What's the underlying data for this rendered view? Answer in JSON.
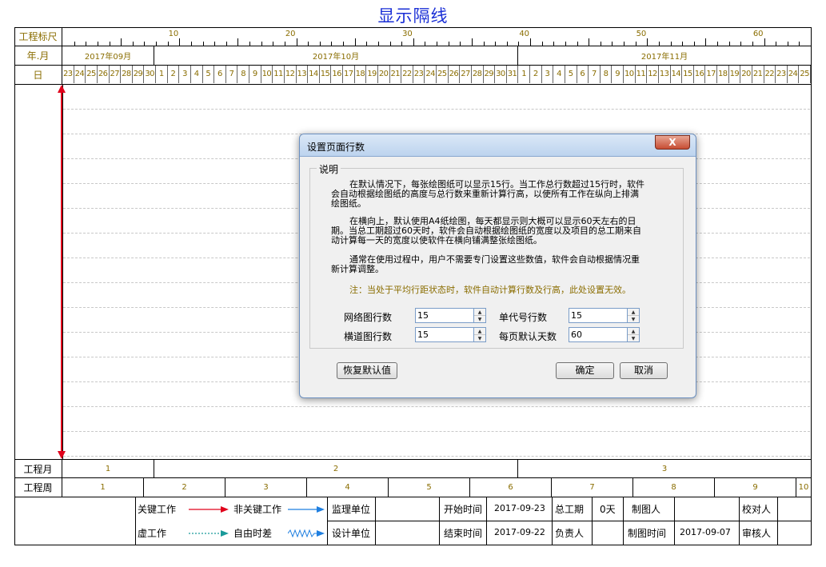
{
  "title": "显示隔线",
  "header": {
    "ruler_label": "工程标尺",
    "ruler_ticks": [
      "10",
      "20",
      "30",
      "40",
      "50",
      "60"
    ],
    "month_label": "年.月",
    "months": [
      "2017年09月",
      "2017年10月",
      "2017年11月"
    ],
    "day_label": "日",
    "days": [
      "23",
      "24",
      "25",
      "26",
      "27",
      "28",
      "29",
      "30",
      "1",
      "2",
      "3",
      "4",
      "5",
      "6",
      "7",
      "8",
      "9",
      "10",
      "11",
      "12",
      "13",
      "14",
      "15",
      "16",
      "17",
      "18",
      "19",
      "20",
      "21",
      "22",
      "23",
      "24",
      "25",
      "26",
      "27",
      "28",
      "29",
      "30",
      "31",
      "1",
      "2",
      "3",
      "4",
      "5",
      "6",
      "7",
      "8",
      "9",
      "10",
      "11",
      "12",
      "13",
      "14",
      "15",
      "16",
      "17",
      "18",
      "19",
      "20",
      "21",
      "22",
      "23",
      "24",
      "25"
    ]
  },
  "footer": {
    "month_label": "工程月",
    "months": [
      "1",
      "2",
      "3"
    ],
    "week_label": "工程周",
    "weeks": [
      "1",
      "2",
      "3",
      "4",
      "5",
      "6",
      "7",
      "8",
      "9",
      "10"
    ]
  },
  "legend": {
    "critical": "关键工作",
    "noncritical": "非关键工作",
    "virtual": "虚工作",
    "float": "自由时差",
    "supervisor": "监理单位",
    "designer": "设计单位",
    "start_label": "开始时间",
    "start_value": "2017-09-23",
    "end_label": "结束时间",
    "end_value": "2017-09-22",
    "duration_label": "总工期",
    "duration_value": "0天",
    "owner_label": "负责人",
    "drawer_label": "制图人",
    "draw_time_label": "制图时间",
    "draw_time_value": "2017-09-07",
    "checker_label": "校对人",
    "reviewer_label": "审核人"
  },
  "dialog": {
    "title": "设置页面行数",
    "close": "X",
    "group_label": "说明",
    "para1a": "在默认情况下，每张绘图纸可以显示15行。当工作总行数超过15行时，软件",
    "para1b": "会自动根据绘图纸的高度与总行数来重新计算行高，以使所有工作在纵向上排满",
    "para1c": "绘图纸。",
    "para2a": "在横向上，默认使用A4纸绘图，每天都显示则大概可以显示60天左右的日",
    "para2b": "期。当总工期超过60天时，软件会自动根据绘图纸的宽度以及项目的总工期来自",
    "para2c": "动计算每一天的宽度以使软件在横向铺满整张绘图纸。",
    "para3a": "通常在使用过程中，用户不需要专门设置这些数值，软件会自动根据情况重",
    "para3b": "新计算调整。",
    "note": "注：当处于平均行距状态时，软件自动计算行数及行高，此处设置无效。",
    "net_rows_label": "网络图行数",
    "net_rows_value": "15",
    "single_rows_label": "单代号行数",
    "single_rows_value": "15",
    "bar_rows_label": "横道图行数",
    "bar_rows_value": "15",
    "days_label": "每页默认天数",
    "days_value": "60",
    "restore": "恢复默认值",
    "ok": "确定",
    "cancel": "取消"
  },
  "colors": {
    "title": "#1a2fd6",
    "label": "#8a6d00",
    "critical": "#e0001b",
    "noncritical": "#1f7fe0",
    "virtual": "#1a9a9a"
  }
}
